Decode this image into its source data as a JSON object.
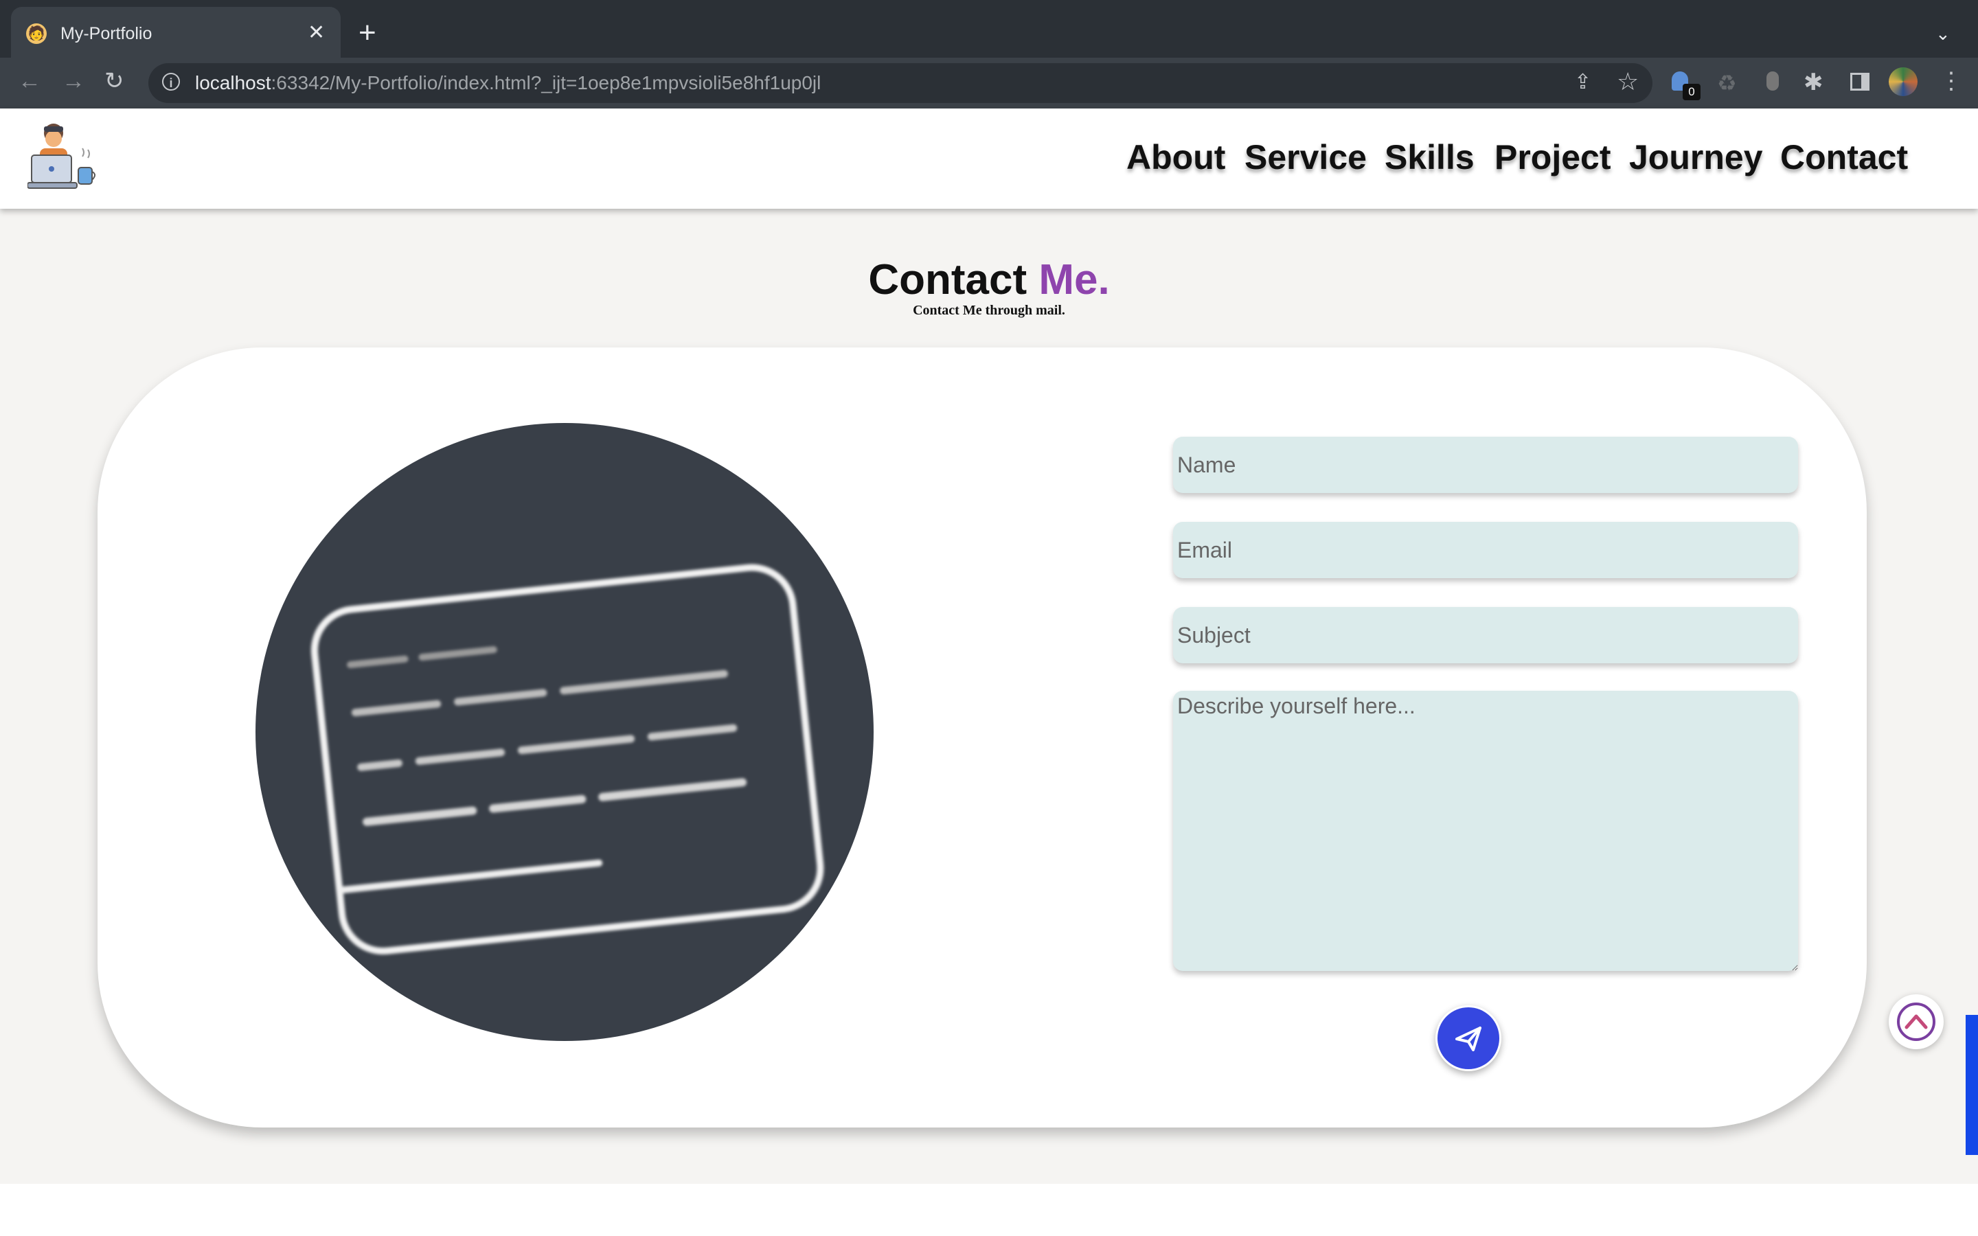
{
  "browser": {
    "tab_title": "My-Portfolio",
    "tab_close": "✕",
    "new_tab": "+",
    "tab_menu": "⌄",
    "url_host": "localhost",
    "url_rest": ":63342/My-Portfolio/index.html?_ijt=1oep8e1mpvsioli5e8hf1up0jl",
    "extension_badge": "0",
    "icons": [
      "back-icon",
      "forward-icon",
      "reload-icon",
      "info-icon",
      "share-icon",
      "star-icon",
      "extension-icon",
      "puzzle-icon",
      "side-panel-icon",
      "profile-avatar",
      "menu-icon"
    ]
  },
  "nav": {
    "about": "About",
    "service": "Service",
    "skills": "Skills",
    "project": "Project",
    "journey": "Journey",
    "contact": "Contact"
  },
  "contact": {
    "heading_main": "Contact",
    "heading_accent": "Me.",
    "subheading": "Contact Me through mail.",
    "name_placeholder": "Name",
    "email_placeholder": "Email",
    "subject_placeholder": "Subject",
    "message_placeholder": "Describe yourself here...",
    "send_icon": "paper-plane-icon"
  },
  "colors": {
    "accent": "#8e44ad",
    "send_button": "#3547e0",
    "field_bg": "#dbebeb",
    "illustration_bg": "#393f48",
    "page_bg": "#f5f4f2"
  }
}
